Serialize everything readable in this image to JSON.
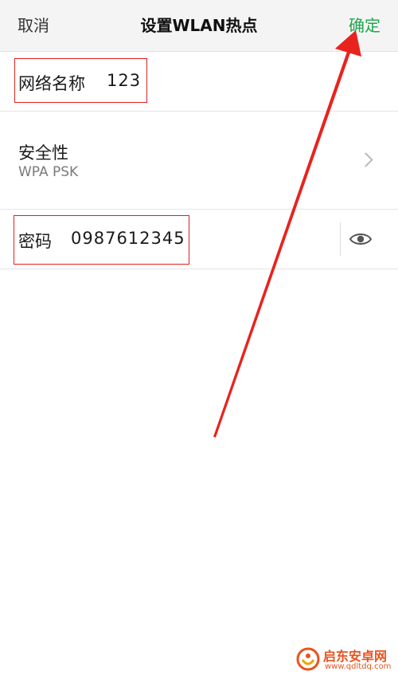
{
  "header": {
    "cancel_label": "取消",
    "title": "设置WLAN热点",
    "confirm_label": "确定"
  },
  "ssid_row": {
    "label": "网络名称",
    "value": "123"
  },
  "security_row": {
    "label": "安全性",
    "value": "WPA PSK"
  },
  "password_row": {
    "label": "密码",
    "value": "0987612345"
  },
  "icons": {
    "security_chevron": "chevron-right-icon",
    "password_visibility": "eye-icon"
  },
  "colors": {
    "confirm_green": "#1fa64a",
    "annotation_red": "#e02020",
    "header_bg": "#f4f4f4"
  },
  "watermark": {
    "text": "启东安卓网",
    "url": "www.qdltdq.com"
  }
}
